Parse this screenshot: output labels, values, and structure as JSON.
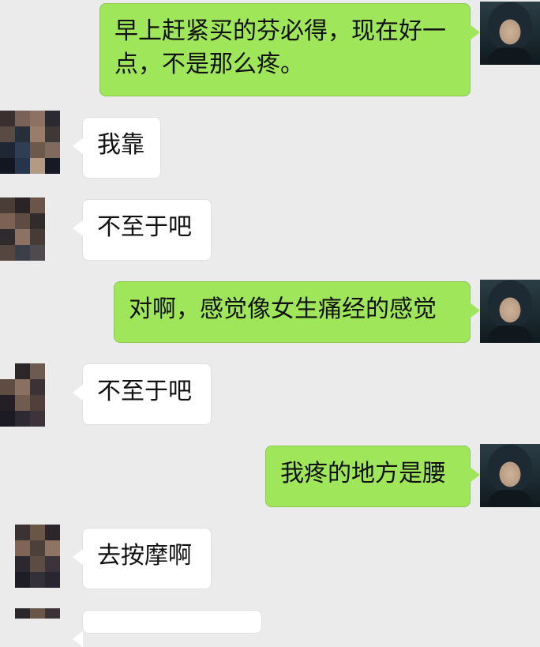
{
  "chat": {
    "messages": [
      {
        "sender": "me",
        "text": "早上赶紧买的芬必得，现在好一点，不是那么疼。"
      },
      {
        "sender": "them",
        "text": "我靠"
      },
      {
        "sender": "them",
        "text": "不至于吧"
      },
      {
        "sender": "me",
        "text": "对啊，感觉像女生痛经的感觉"
      },
      {
        "sender": "them",
        "text": "不至于吧"
      },
      {
        "sender": "me",
        "text": "我疼的地方是腰"
      },
      {
        "sender": "them",
        "text": "去按摩啊"
      }
    ]
  },
  "avatars": {
    "me": "user-avatar-photo",
    "them": "pixelated-contact-avatar"
  },
  "colors": {
    "background": "#ebebeb",
    "outgoing_bubble": "#9fe65a",
    "incoming_bubble": "#ffffff"
  }
}
